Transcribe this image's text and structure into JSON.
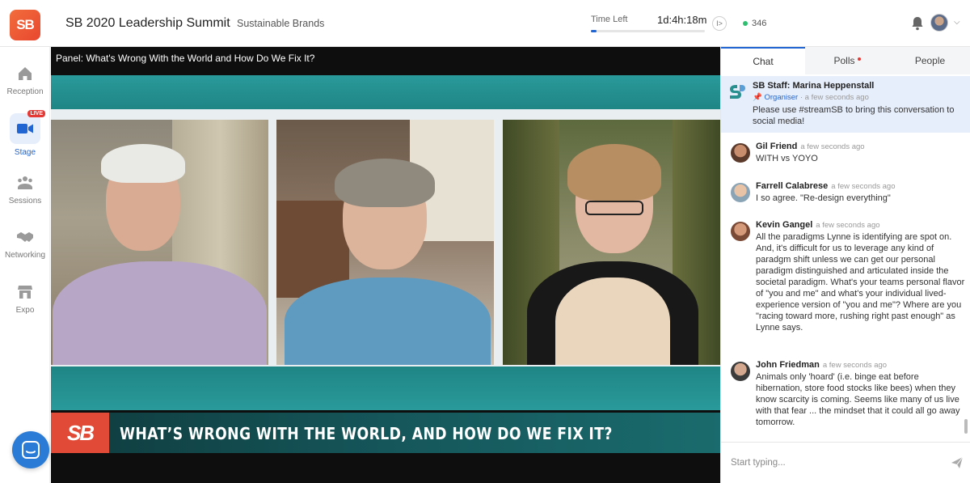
{
  "header": {
    "logo_text": "SB",
    "event_title": "SB 2020 Leadership Summit",
    "organizer": "Sustainable Brands",
    "time_left_label": "Time Left",
    "time_left_value": "1d:4h:18m",
    "time_progress_fraction": 0.05,
    "collapse_icon": "I>",
    "viewer_count": "346",
    "notification_icon": "bell-icon",
    "user_menu_icon": "chevron-down-icon"
  },
  "sidebar": {
    "items": [
      {
        "label": "Reception",
        "icon": "home-icon"
      },
      {
        "label": "Stage",
        "icon": "video-camera-icon",
        "badge": "LIVE",
        "active": true
      },
      {
        "label": "Sessions",
        "icon": "group-icon"
      },
      {
        "label": "Networking",
        "icon": "handshake-icon"
      },
      {
        "label": "Expo",
        "icon": "store-icon"
      }
    ],
    "chat_bubble_icon": "chat-bubble-icon"
  },
  "stage": {
    "session_title": "Panel: What's Wrong With the World and How Do We Fix It?",
    "lower_third_logo": "SB",
    "lower_third_text": "WHAT’S WRONG WITH THE WORLD, AND HOW DO WE FIX IT?"
  },
  "panel": {
    "tabs": [
      {
        "label": "Chat",
        "active": true
      },
      {
        "label": "Polls",
        "has_dot": true
      },
      {
        "label": "People"
      }
    ],
    "pinned": {
      "name": "SB Staff: Marina Heppenstall",
      "role": "Organiser",
      "time": "a few seconds ago",
      "text": "Please use #streamSB to bring this conversation to social media!"
    },
    "messages": [
      {
        "name": "Gil Friend",
        "time": "a few seconds ago",
        "text": "WITH vs YOYO"
      },
      {
        "name": "Farrell Calabrese",
        "time": "a few seconds ago",
        "text": "I so agree. \"Re-design everything\""
      },
      {
        "name": "Kevin Gangel",
        "time": "a few seconds ago",
        "text": "All the paradigms Lynne is identifying are spot on. And, it's difficult for us to leverage any kind of paradgm shift unless we can get our personal paradigm distinguished and articulated inside the societal paradigm. What's your teams personal flavor of \"you and me\" and what's your individual lived-experience version of \"you and me\"? Where are you \"racing toward more, rushing right past enough\" as Lynne says."
      },
      {
        "name": "John Friedman",
        "time": "a few seconds ago",
        "text": "Animals only 'hoard' (i.e. binge eat before hibernation, store food stocks like bees) when they know scarcity is coming. Seems like many of us live with that fear ... the mindset that it could all go away tomorrow."
      }
    ],
    "composer_placeholder": "Start typing..."
  },
  "colors": {
    "accent": "#2065d1",
    "brand": "#e8472e",
    "live": "#e53935",
    "online": "#2fbf71"
  }
}
